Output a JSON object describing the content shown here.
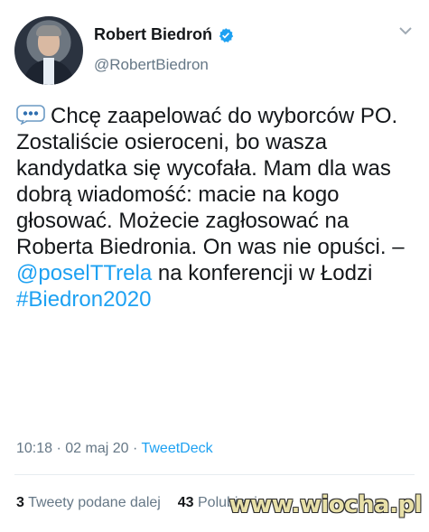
{
  "author": {
    "display_name": "Robert Biedroń",
    "handle": "@RobertBiedron",
    "verified_icon": "verified-badge-icon",
    "avatar_icon": "profile-photo"
  },
  "tweet": {
    "emoji_icon": "speech-balloon-icon",
    "text_part1": "Chcę zaapelować do wyborców PO. Zostaliście osieroceni, bo wasza kandydatka się wycofała. Mam dla was dobrą wiadomość: macie na kogo głosować. Możecie zagłosować na Roberta Biedronia. On was nie opuści. – ",
    "mention": "@poselTTrela",
    "text_part2": " na konferencji w Łodzi",
    "hashtag": "#Biedron2020"
  },
  "meta": {
    "time": "10:18",
    "date": "02 maj 20",
    "separator": "·",
    "source": "TweetDeck"
  },
  "stats": {
    "retweets_count": "3",
    "retweets_label": "Tweety podane dalej",
    "likes_count": "43",
    "likes_label": "Polubienia"
  },
  "watermark": "www.wiocha.pl",
  "colors": {
    "link": "#1da1f2",
    "text": "#14171a",
    "secondary": "#657786"
  }
}
